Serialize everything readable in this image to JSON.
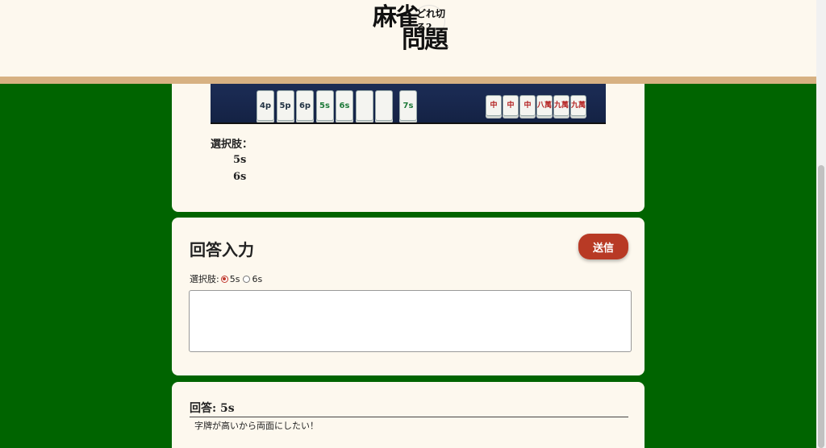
{
  "header": {
    "logo_line1": "麻雀",
    "logo_line2": "問題",
    "logo_sub": "どれ切る?"
  },
  "board": {
    "hand_tiles": [
      {
        "label": "4p",
        "suit": "pin"
      },
      {
        "label": "5p",
        "suit": "pin"
      },
      {
        "label": "6p",
        "suit": "pin"
      },
      {
        "label": "5s",
        "suit": "sou"
      },
      {
        "label": "6s",
        "suit": "sou"
      },
      {
        "label": "",
        "suit": "blank"
      },
      {
        "label": "",
        "suit": "blank"
      }
    ],
    "drawn_tile": {
      "label": "7s",
      "suit": "sou"
    },
    "meld_tiles": [
      {
        "label": "中",
        "suit": "man"
      },
      {
        "label": "中",
        "suit": "man"
      },
      {
        "label": "中",
        "suit": "man"
      },
      {
        "label": "八萬",
        "suit": "man"
      },
      {
        "label": "九萬",
        "suit": "man"
      },
      {
        "label": "九萬",
        "suit": "man"
      }
    ],
    "corner_tile": {
      "label": "",
      "suit": "sou"
    }
  },
  "question": {
    "choices_label": "選択肢：",
    "choices": [
      "5s",
      "6s"
    ]
  },
  "answer_form": {
    "title": "回答入力",
    "submit_label": "送信",
    "radio_label": "選択肢:",
    "options": [
      {
        "label": "5s",
        "checked": true
      },
      {
        "label": "6s",
        "checked": false
      }
    ],
    "comment_value": ""
  },
  "result": {
    "title": "回答: 5s",
    "comment": "字牌が高いから両面にしたい！"
  }
}
